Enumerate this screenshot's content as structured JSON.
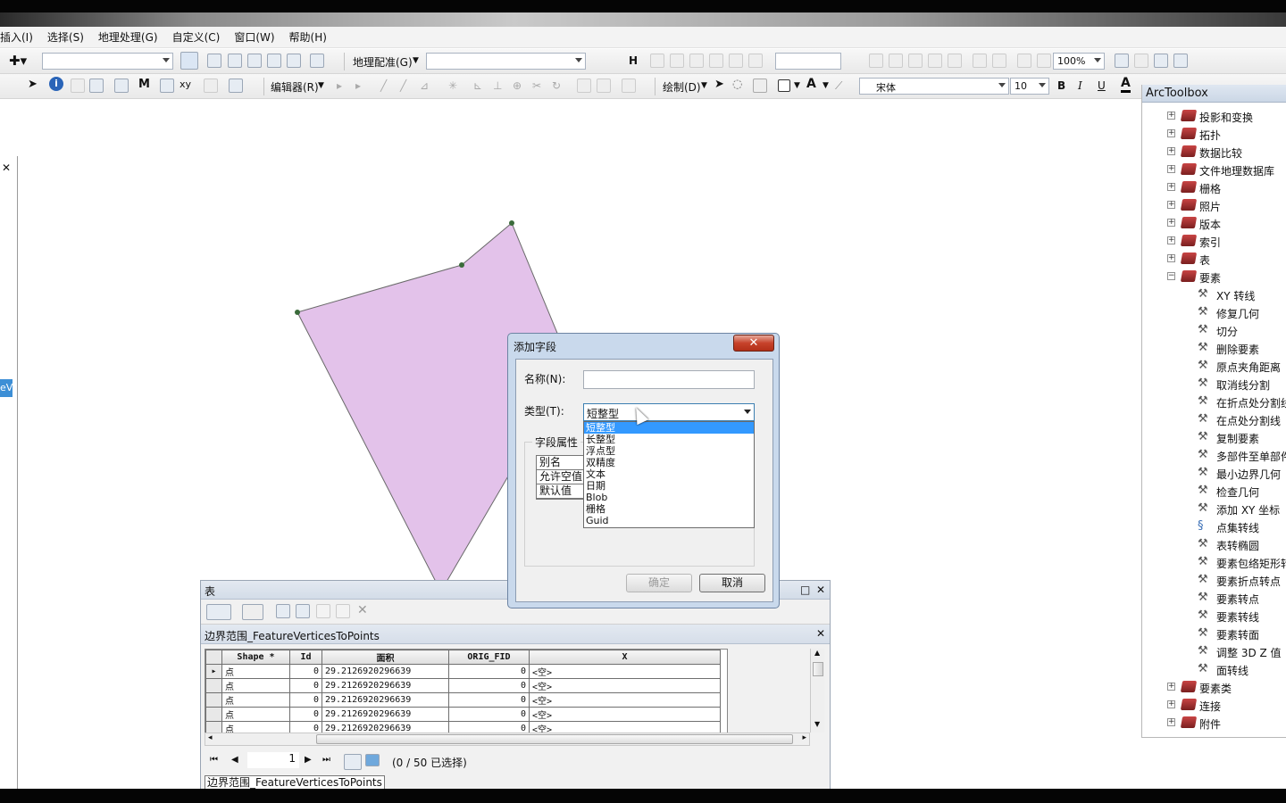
{
  "menubar": {
    "items": [
      "插入(I)",
      "选择(S)",
      "地理处理(G)",
      "自定义(C)",
      "窗口(W)",
      "帮助(H)"
    ]
  },
  "toolbar1": {
    "georef_label": "地理配准(G)",
    "zoom_value": "100%"
  },
  "toolbar2": {
    "editor_label": "编辑器(R)",
    "draw_label": "绘制(D)",
    "font_name": "宋体",
    "font_size": "10",
    "bold": "B",
    "italic": "I",
    "underline": "U",
    "font_color": "A"
  },
  "toolbox": {
    "title": "ArcToolbox",
    "items": [
      {
        "label": "投影和变换",
        "type": "toolset",
        "expanded": false
      },
      {
        "label": "拓扑",
        "type": "toolset",
        "expanded": false
      },
      {
        "label": "数据比较",
        "type": "toolset",
        "expanded": false
      },
      {
        "label": "文件地理数据库",
        "type": "toolset",
        "expanded": false
      },
      {
        "label": "栅格",
        "type": "toolset",
        "expanded": false
      },
      {
        "label": "照片",
        "type": "toolset",
        "expanded": false
      },
      {
        "label": "版本",
        "type": "toolset",
        "expanded": false
      },
      {
        "label": "索引",
        "type": "toolset",
        "expanded": false
      },
      {
        "label": "表",
        "type": "toolset",
        "expanded": false
      },
      {
        "label": "要素",
        "type": "toolset",
        "expanded": true
      },
      {
        "label": "XY 转线",
        "type": "tool"
      },
      {
        "label": "修复几何",
        "type": "tool"
      },
      {
        "label": "切分",
        "type": "tool"
      },
      {
        "label": "删除要素",
        "type": "tool"
      },
      {
        "label": "原点夹角距离",
        "type": "tool"
      },
      {
        "label": "取消线分割",
        "type": "tool"
      },
      {
        "label": "在折点处分割线",
        "type": "tool"
      },
      {
        "label": "在点处分割线",
        "type": "tool"
      },
      {
        "label": "复制要素",
        "type": "tool"
      },
      {
        "label": "多部件至单部件",
        "type": "tool"
      },
      {
        "label": "最小边界几何",
        "type": "tool"
      },
      {
        "label": "检查几何",
        "type": "tool"
      },
      {
        "label": "添加 XY 坐标",
        "type": "tool"
      },
      {
        "label": "点集转线",
        "type": "script"
      },
      {
        "label": "表转椭圆",
        "type": "tool"
      },
      {
        "label": "要素包络矩形转",
        "type": "tool"
      },
      {
        "label": "要素折点转点",
        "type": "tool"
      },
      {
        "label": "要素转点",
        "type": "tool"
      },
      {
        "label": "要素转线",
        "type": "tool"
      },
      {
        "label": "要素转面",
        "type": "tool"
      },
      {
        "label": "调整 3D Z 值",
        "type": "tool"
      },
      {
        "label": "面转线",
        "type": "tool"
      },
      {
        "label": "要素类",
        "type": "toolset",
        "expanded": false
      },
      {
        "label": "连接",
        "type": "toolset",
        "expanded": false
      },
      {
        "label": "附件",
        "type": "toolset",
        "expanded": false
      }
    ]
  },
  "table_window": {
    "title": "表",
    "layer_name": "边界范围_FeatureVerticesToPoints",
    "columns": [
      "Shape *",
      "Id",
      "面积",
      "ORIG_FID",
      "X"
    ],
    "rows": [
      [
        "点",
        "0",
        "29.2126920296639",
        "0",
        "<空>"
      ],
      [
        "点",
        "0",
        "29.2126920296639",
        "0",
        "<空>"
      ],
      [
        "点",
        "0",
        "29.2126920296639",
        "0",
        "<空>"
      ],
      [
        "点",
        "0",
        "29.2126920296639",
        "0",
        "<空>"
      ],
      [
        "点",
        "0",
        "29.2126920296639",
        "0",
        "<空>"
      ]
    ],
    "page_number": "1",
    "selection_status": "(0 / 50 已选择)",
    "tab_label": "边界范围_FeatureVerticesToPoints"
  },
  "dialog": {
    "title": "添加字段",
    "close_label": "✕",
    "name_label": "名称(N):",
    "name_value": "",
    "type_label": "类型(T):",
    "type_selected": "短整型",
    "type_options": [
      "短整型",
      "长整型",
      "浮点型",
      "双精度",
      "文本",
      "日期",
      "Blob",
      "栅格",
      "Guid"
    ],
    "field_props_label": "字段属性",
    "field_props": [
      "别名",
      "允许空值",
      "默认值"
    ],
    "ok_label": "确定",
    "cancel_label": "取消"
  },
  "left_panel": {
    "close": "✕",
    "selected_fragment": "eVe"
  },
  "colors": {
    "polygon_fill": "#e3c2ea",
    "polygon_stroke": "#6a6a6a",
    "vertex": "#3a6b3a",
    "selection": "#3399ff"
  }
}
